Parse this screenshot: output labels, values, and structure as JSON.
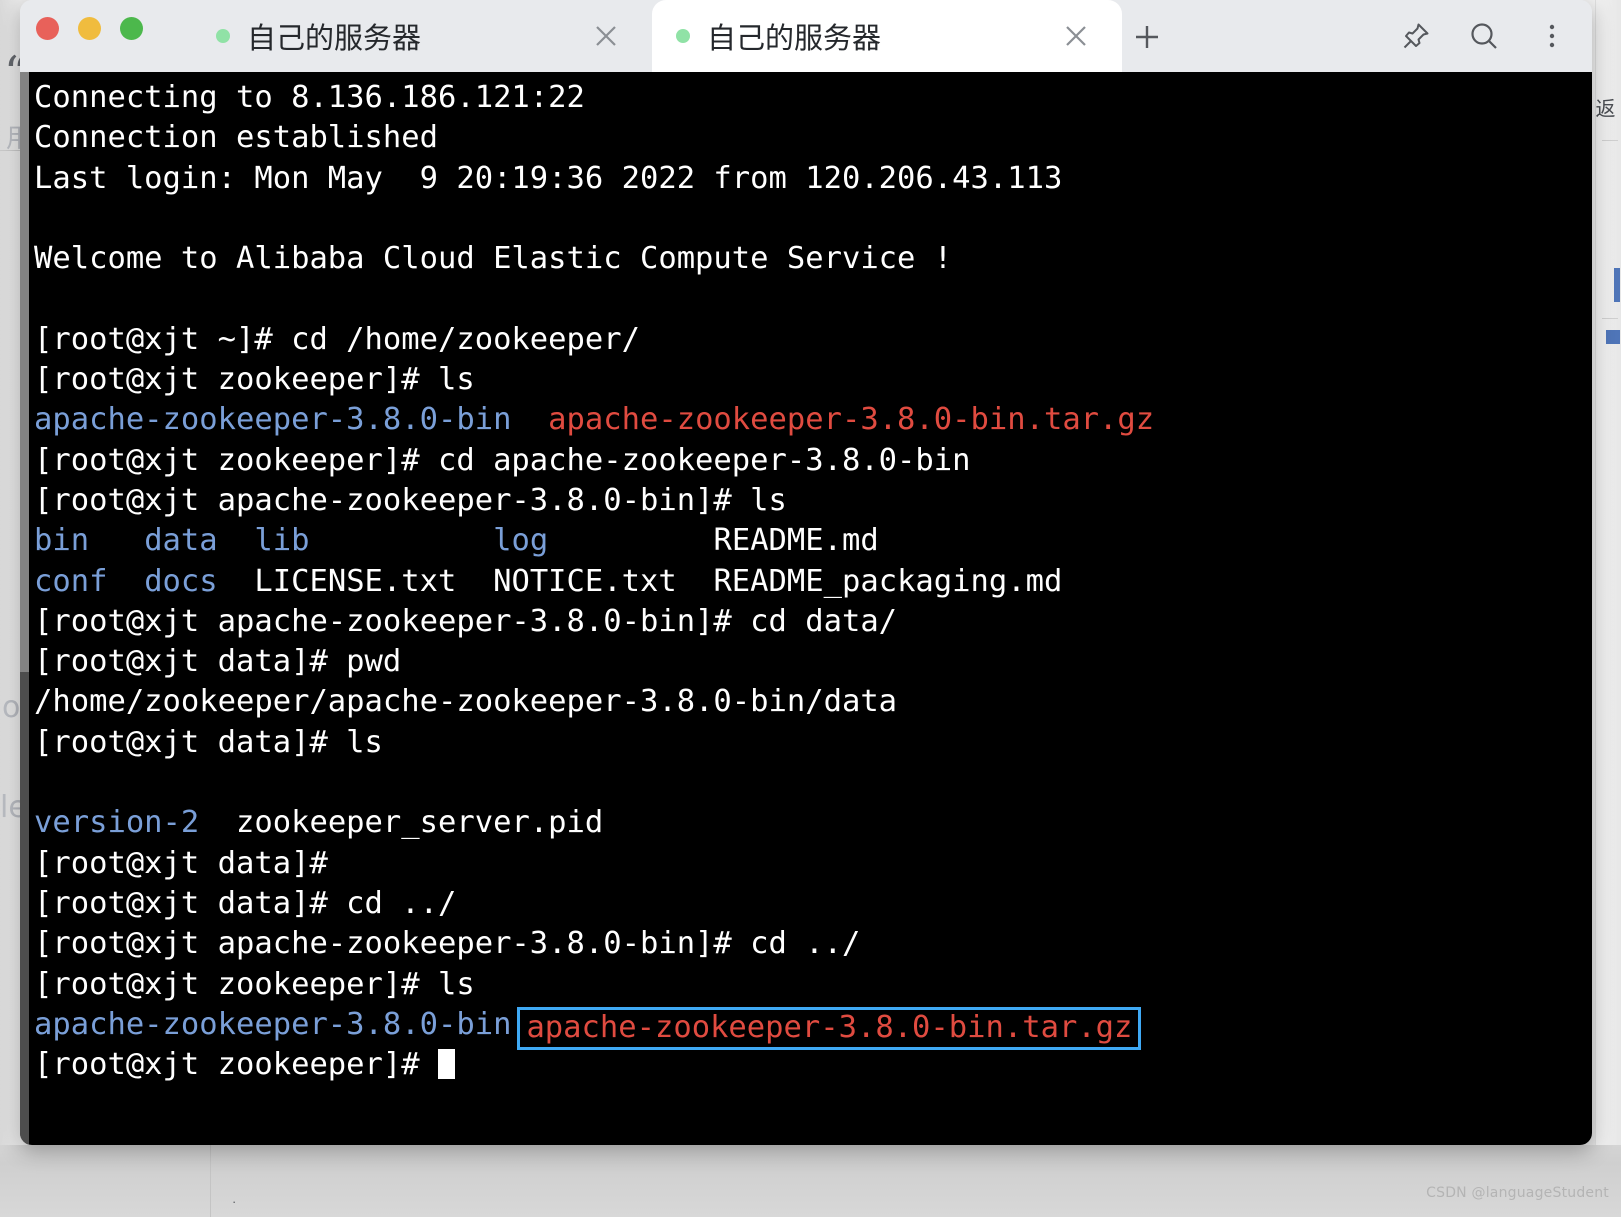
{
  "window": {
    "traffic_lights": [
      {
        "name": "close",
        "color": "#e8615a"
      },
      {
        "name": "minimize",
        "color": "#f0bc3e"
      },
      {
        "name": "maximize",
        "color": "#4cb84c"
      }
    ]
  },
  "tabs": [
    {
      "label": "自己的服务器",
      "active": false,
      "status_color": "#90e2a6",
      "close_label": "×"
    },
    {
      "label": "自己的服务器",
      "active": true,
      "status_color": "#90e2a6",
      "close_label": "×"
    }
  ],
  "titlebar": {
    "new_tab_icon": "plus-icon",
    "actions": [
      {
        "name": "pin-icon",
        "label": "Pin"
      },
      {
        "name": "search-icon",
        "label": "Search"
      },
      {
        "name": "more-options-icon",
        "label": "More"
      }
    ]
  },
  "terminal": {
    "colors": {
      "background": "#000000",
      "foreground": "#ffffff",
      "directory": "#7a9fd8",
      "archive": "#e04b40",
      "highlight_border": "#3fa9f5"
    },
    "prompt_user": "root",
    "prompt_host": "xjt",
    "lines": [
      {
        "id": "l01",
        "segments": [
          {
            "text": "Connecting to 8.136.186.121:22",
            "cls": "plain"
          }
        ]
      },
      {
        "id": "l02",
        "segments": [
          {
            "text": "Connection established",
            "cls": "plain"
          }
        ]
      },
      {
        "id": "l03",
        "segments": [
          {
            "text": "Last login: Mon May  9 20:19:36 2022 from 120.206.43.113",
            "cls": "plain"
          }
        ]
      },
      {
        "id": "l04",
        "segments": []
      },
      {
        "id": "l05",
        "segments": [
          {
            "text": "Welcome to Alibaba Cloud Elastic Compute Service !",
            "cls": "plain"
          }
        ]
      },
      {
        "id": "l06",
        "segments": []
      },
      {
        "id": "l07",
        "segments": [
          {
            "text": "[root@xjt ~]# cd /home/zookeeper/",
            "cls": "plain"
          }
        ]
      },
      {
        "id": "l08",
        "segments": [
          {
            "text": "[root@xjt zookeeper]# ls",
            "cls": "plain"
          }
        ]
      },
      {
        "id": "l09",
        "segments": [
          {
            "text": "apache-zookeeper-3.8.0-bin",
            "cls": "dir"
          },
          {
            "text": "  ",
            "cls": "plain"
          },
          {
            "text": "apache-zookeeper-3.8.0-bin.tar.gz",
            "cls": "arc"
          }
        ]
      },
      {
        "id": "l10",
        "segments": [
          {
            "text": "[root@xjt zookeeper]# cd apache-zookeeper-3.8.0-bin",
            "cls": "plain"
          }
        ]
      },
      {
        "id": "l11",
        "segments": [
          {
            "text": "[root@xjt apache-zookeeper-3.8.0-bin]# ls",
            "cls": "plain"
          }
        ]
      },
      {
        "id": "l12",
        "segments": [
          {
            "text": "bin",
            "cls": "dir"
          },
          {
            "text": "   ",
            "cls": "plain"
          },
          {
            "text": "data",
            "cls": "dir"
          },
          {
            "text": "  ",
            "cls": "plain"
          },
          {
            "text": "lib",
            "cls": "dir"
          },
          {
            "text": "          ",
            "cls": "plain"
          },
          {
            "text": "log",
            "cls": "dir"
          },
          {
            "text": "         ",
            "cls": "plain"
          },
          {
            "text": "README.md",
            "cls": "plain"
          }
        ]
      },
      {
        "id": "l13",
        "segments": [
          {
            "text": "conf",
            "cls": "dir"
          },
          {
            "text": "  ",
            "cls": "plain"
          },
          {
            "text": "docs",
            "cls": "dir"
          },
          {
            "text": "  ",
            "cls": "plain"
          },
          {
            "text": "LICENSE.txt  NOTICE.txt  README_packaging.md",
            "cls": "plain"
          }
        ]
      },
      {
        "id": "l14",
        "segments": [
          {
            "text": "[root@xjt apache-zookeeper-3.8.0-bin]# cd data/",
            "cls": "plain"
          }
        ]
      },
      {
        "id": "l15",
        "segments": [
          {
            "text": "[root@xjt data]# pwd",
            "cls": "plain"
          }
        ]
      },
      {
        "id": "l16",
        "segments": [
          {
            "text": "/home/zookeeper/apache-zookeeper-3.8.0-bin/data",
            "cls": "plain"
          }
        ]
      },
      {
        "id": "l17",
        "segments": [
          {
            "text": "[root@xjt data]# ls",
            "cls": "plain"
          }
        ]
      },
      {
        "id": "l18",
        "segments": []
      },
      {
        "id": "l19",
        "segments": [
          {
            "text": "version-2",
            "cls": "dir"
          },
          {
            "text": "  ",
            "cls": "plain"
          },
          {
            "text": "zookeeper_server.pid",
            "cls": "plain"
          }
        ]
      },
      {
        "id": "l20",
        "segments": [
          {
            "text": "[root@xjt data]#",
            "cls": "plain"
          }
        ]
      },
      {
        "id": "l21",
        "segments": [
          {
            "text": "[root@xjt data]# cd ../",
            "cls": "plain"
          }
        ]
      },
      {
        "id": "l22",
        "segments": [
          {
            "text": "[root@xjt apache-zookeeper-3.8.0-bin]# cd ../",
            "cls": "plain"
          }
        ]
      },
      {
        "id": "l23",
        "segments": [
          {
            "text": "[root@xjt zookeeper]# ls",
            "cls": "plain"
          }
        ]
      },
      {
        "id": "l24",
        "segments": [
          {
            "text": "apache-zookeeper-3.8.0-bin",
            "cls": "dir"
          }
        ],
        "highlight": {
          "text": "apache-zookeeper-3.8.0-bin.tar.gz",
          "cls": "arc"
        }
      },
      {
        "id": "l25",
        "segments": [
          {
            "text": "[root@xjt zookeeper]# ",
            "cls": "plain"
          }
        ],
        "cursor": true
      }
    ]
  },
  "background_window": {
    "left_glyphs": [
      "用",
      "o",
      "le"
    ],
    "right_glyph": "返",
    "bottom_dot": "·"
  },
  "watermark": "CSDN @languageStudent"
}
